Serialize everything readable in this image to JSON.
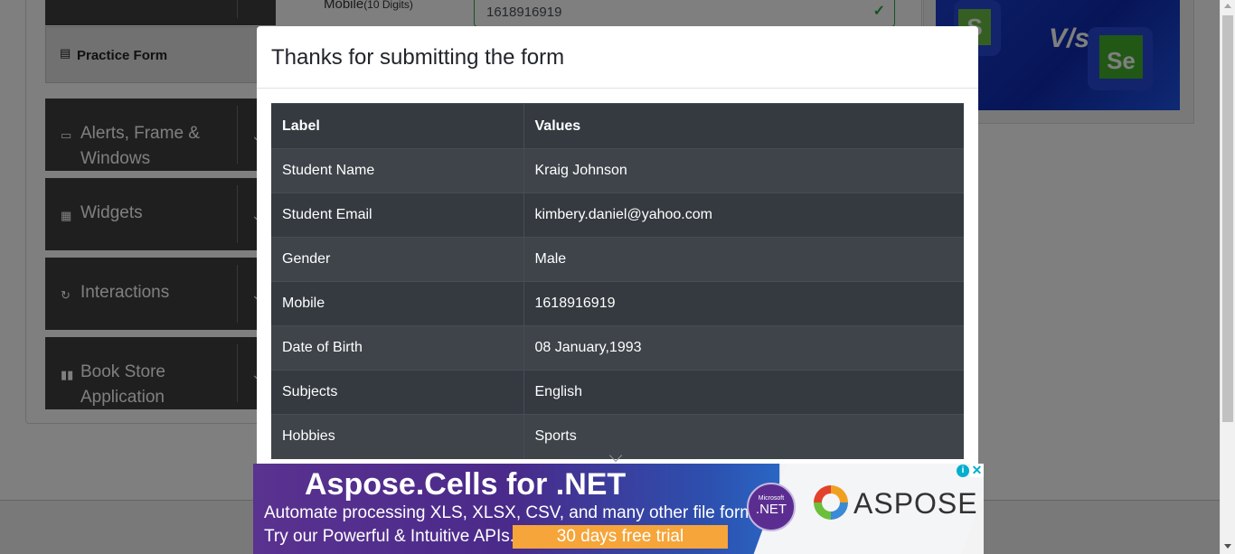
{
  "page": {
    "mobile_label": "Mobile",
    "mobile_hint": "(10 Digits)",
    "mobile_value": "1618916919"
  },
  "sidebar": {
    "practice_form": "Practice Form",
    "groups": [
      {
        "label": "Alerts, Frame & Windows",
        "icon": "window-icon"
      },
      {
        "label": "Widgets",
        "icon": "widgets-icon"
      },
      {
        "label": "Interactions",
        "icon": "interactions-icon"
      },
      {
        "label": "Book Store Application",
        "icon": "books-icon"
      }
    ]
  },
  "banner": {
    "vs_text": "V/s",
    "left_logo": "S",
    "right_logo": "Se"
  },
  "modal": {
    "title": "Thanks for submitting the form",
    "columns": [
      "Label",
      "Values"
    ],
    "rows": [
      {
        "label": "Student Name",
        "value": "Kraig Johnson"
      },
      {
        "label": "Student Email",
        "value": "kimbery.daniel@yahoo.com"
      },
      {
        "label": "Gender",
        "value": "Male"
      },
      {
        "label": "Mobile",
        "value": "1618916919"
      },
      {
        "label": "Date of Birth",
        "value": "08 January,1993"
      },
      {
        "label": "Subjects",
        "value": "English"
      },
      {
        "label": "Hobbies",
        "value": "Sports"
      }
    ]
  },
  "ad": {
    "title": "Aspose.Cells for .NET",
    "line1": "Automate processing XLS, XLSX, CSV, and many other file formats.",
    "line2": "Try our Powerful & Intuitive APIs.",
    "cta": "30 days free trial",
    "net_small": "Microsoft",
    "net_big": ".NET",
    "brand": "ASPOSE",
    "info_glyph": "i",
    "close_glyph": "✕"
  },
  "colors": {
    "table_dark": "#343a40",
    "table_stripe": "#3e444a",
    "valid_green": "#28a745",
    "sidebar_bg": "#3f3f3f"
  }
}
